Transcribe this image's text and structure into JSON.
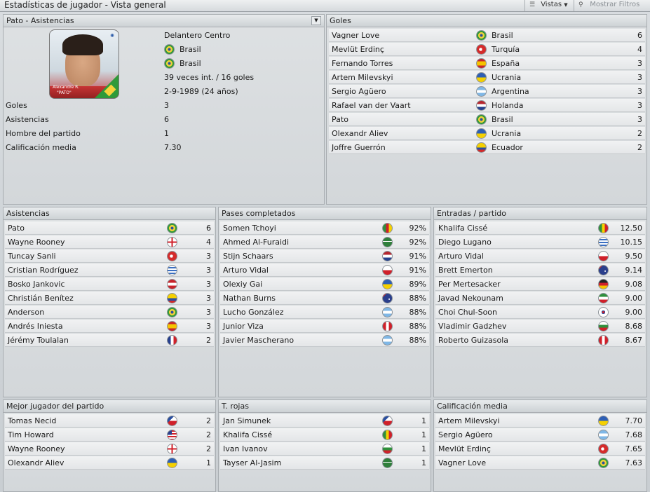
{
  "window": {
    "title": "Estadísticas de jugador - Vista general",
    "views_label": "Vistas",
    "filters_label": "Mostrar Filtros"
  },
  "player": {
    "panel_title": "Pato - Asistencias",
    "photo_caption_line1": "Alexandre R.",
    "photo_caption_line2": "\"PATO\"",
    "position": "Delantero Centro",
    "nationality": "Brasil",
    "nationality2": "Brasil",
    "caps": "39 veces int. / 16 goles",
    "dob": "2-9-1989 (24 años)",
    "stats": [
      {
        "label": "Goles",
        "value": "3"
      },
      {
        "label": "Asistencias",
        "value": "6"
      },
      {
        "label": "Hombre del partido",
        "value": "1"
      },
      {
        "label": "Calificación media",
        "value": "7.30"
      }
    ]
  },
  "goals": {
    "title": "Goles",
    "rows": [
      {
        "name": "Vagner Love",
        "flag": "brazil",
        "country": "Brasil",
        "value": "6"
      },
      {
        "name": "Mevlüt Erdinç",
        "flag": "turkey",
        "country": "Turquía",
        "value": "4"
      },
      {
        "name": "Fernando Torres",
        "flag": "spain",
        "country": "España",
        "value": "3"
      },
      {
        "name": "Artem Milevskyi",
        "flag": "ukraine",
        "country": "Ucrania",
        "value": "3"
      },
      {
        "name": "Sergio Agüero",
        "flag": "argentina",
        "country": "Argentina",
        "value": "3"
      },
      {
        "name": "Rafael van der Vaart",
        "flag": "netherlands",
        "country": "Holanda",
        "value": "3"
      },
      {
        "name": "Pato",
        "flag": "brazil",
        "country": "Brasil",
        "value": "3"
      },
      {
        "name": "Olexandr Aliev",
        "flag": "ukraine",
        "country": "Ucrania",
        "value": "2"
      },
      {
        "name": "Joffre Guerrón",
        "flag": "ecuador",
        "country": "Ecuador",
        "value": "2"
      }
    ]
  },
  "assists": {
    "title": "Asistencias",
    "rows": [
      {
        "name": "Pato",
        "flag": "brazil",
        "value": "6"
      },
      {
        "name": "Wayne Rooney",
        "flag": "england",
        "value": "4"
      },
      {
        "name": "Tuncay Sanli",
        "flag": "turkey",
        "value": "3"
      },
      {
        "name": "Cristian Rodríguez",
        "flag": "uruguay",
        "value": "3"
      },
      {
        "name": "Bosko Jankovic",
        "flag": "serbia",
        "value": "3"
      },
      {
        "name": "Christián Benítez",
        "flag": "ecuador",
        "value": "3"
      },
      {
        "name": "Anderson",
        "flag": "brazil",
        "value": "3"
      },
      {
        "name": "Andrés Iniesta",
        "flag": "spain",
        "value": "3"
      },
      {
        "name": "Jérémy Toulalan",
        "flag": "france",
        "value": "2"
      }
    ]
  },
  "passes": {
    "title": "Pases completados",
    "rows": [
      {
        "name": "Somen Tchoyi",
        "flag": "cameroon",
        "value": "92%"
      },
      {
        "name": "Ahmed Al-Furaidi",
        "flag": "saudi",
        "value": "92%"
      },
      {
        "name": "Stijn Schaars",
        "flag": "netherlands",
        "value": "91%"
      },
      {
        "name": "Arturo Vidal",
        "flag": "chile",
        "value": "91%"
      },
      {
        "name": "Olexiy Gai",
        "flag": "ukraine",
        "value": "89%"
      },
      {
        "name": "Nathan Burns",
        "flag": "australia",
        "value": "88%"
      },
      {
        "name": "Lucho González",
        "flag": "argentina",
        "value": "88%"
      },
      {
        "name": "Junior Viza",
        "flag": "peru",
        "value": "88%"
      },
      {
        "name": "Javier Mascherano",
        "flag": "argentina",
        "value": "88%"
      }
    ]
  },
  "tackles": {
    "title": "Entradas / partido",
    "rows": [
      {
        "name": "Khalifa Cissé",
        "flag": "mali",
        "value": "12.50"
      },
      {
        "name": "Diego Lugano",
        "flag": "uruguay",
        "value": "10.15"
      },
      {
        "name": "Arturo Vidal",
        "flag": "chile",
        "value": "9.50"
      },
      {
        "name": "Brett Emerton",
        "flag": "australia",
        "value": "9.14"
      },
      {
        "name": "Per Mertesacker",
        "flag": "germany",
        "value": "9.08"
      },
      {
        "name": "Javad Nekounam",
        "flag": "iran",
        "value": "9.00"
      },
      {
        "name": "Choi Chul-Soon",
        "flag": "korea",
        "value": "9.00"
      },
      {
        "name": "Vladimir Gadzhev",
        "flag": "bulgaria",
        "value": "8.68"
      },
      {
        "name": "Roberto Guizasola",
        "flag": "peru",
        "value": "8.67"
      }
    ]
  },
  "motm": {
    "title": "Mejor jugador del partido",
    "rows": [
      {
        "name": "Tomas Necid",
        "flag": "czech",
        "value": "2"
      },
      {
        "name": "Tim Howard",
        "flag": "usa",
        "value": "2"
      },
      {
        "name": "Wayne Rooney",
        "flag": "england",
        "value": "2"
      },
      {
        "name": "Olexandr Aliev",
        "flag": "ukraine",
        "value": "1"
      }
    ]
  },
  "reds": {
    "title": "T. rojas",
    "rows": [
      {
        "name": "Jan Simunek",
        "flag": "czech",
        "value": "1"
      },
      {
        "name": "Khalifa Cissé",
        "flag": "mali",
        "value": "1"
      },
      {
        "name": "Ivan Ivanov",
        "flag": "bulgaria",
        "value": "1"
      },
      {
        "name": "Tayser Al-Jasim",
        "flag": "saudi",
        "value": "1"
      }
    ]
  },
  "ratings": {
    "title": "Calificación media",
    "rows": [
      {
        "name": "Artem Milevskyi",
        "flag": "ukraine",
        "value": "7.70"
      },
      {
        "name": "Sergio Agüero",
        "flag": "argentina",
        "value": "7.68"
      },
      {
        "name": "Mevlüt Erdinç",
        "flag": "turkey",
        "value": "7.65"
      },
      {
        "name": "Vagner Love",
        "flag": "brazil",
        "value": "7.63"
      }
    ]
  },
  "flag_styles": {
    "brazil": "radial-gradient(circle at 50% 50%, #2a4fa0 0 22%, #f2d23a 23% 48%, #2f9a39 49%)",
    "turkey": "radial-gradient(circle at 42% 50%, #ffffff 0 22%, #d52b2b 23%)",
    "spain": "linear-gradient(#c8242b 0 28%, #f5c400 28% 72%, #c8242b 72%)",
    "ukraine": "linear-gradient(#2e5fb5 0 50%, #f5d000 50%)",
    "argentina": "linear-gradient(#7fb7e6 0 33%, #ffffff 33% 67%, #7fb7e6 67%)",
    "netherlands": "linear-gradient(#b6262f 0 33%, #ffffff 33% 67%, #26428e 67%)",
    "ecuador": "linear-gradient(#f5d000 0 50%, #2a4fa0 50% 75%, #d22a2a 75%)",
    "england": "linear-gradient(90deg, transparent 42%, #d0202a 42% 58%, transparent 58%), linear-gradient(transparent 42%, #d0202a 42% 58%, transparent 58%), #ffffff",
    "uruguay": "repeating-linear-gradient(#ffffff 0 2px, #3b6fc1 2px 4px)",
    "serbia": "linear-gradient(#c8242b 0 33%, #ffffff 33% 67%, #c8242b 67%)",
    "france": "linear-gradient(90deg, #263f8e 0 33%, #ffffff 33% 67%, #d0202a 67%)",
    "cameroon": "linear-gradient(90deg, #2f8f3b 0 33%, #d0202a 33% 67%, #f5d000 67%)",
    "saudi": "linear-gradient(#2f7f3b 0 38%, #ffffff 38% 46%, #2f7f3b 46%)",
    "chile": "linear-gradient(#ffffff 0 50%, #d0202a 50%)",
    "australia": "radial-gradient(circle at 70% 60%, #ffffff 0 8%, transparent 9%), linear-gradient(135deg, #c8242b 0 20%, #2a3f8c 20%)",
    "peru": "linear-gradient(90deg, #d0202a 0 33%, #ffffff 33% 67%, #d0202a 67%)",
    "mali": "linear-gradient(90deg, #2f8f3b 0 33%, #f5d000 33% 67%, #d0202a 67%)",
    "germany": "linear-gradient(#222222 0 33%, #d0202a 33% 67%, #f5c400 67%)",
    "iran": "linear-gradient(#2f8f3b 0 33%, #ffffff 33% 67%, #d0202a 67%)",
    "korea": "radial-gradient(circle at 50% 50%, #d0202a 0 18%, #2a4fa0 19% 28%, #ffffff 29%)",
    "bulgaria": "linear-gradient(#ffffff 0 33%, #2f8f3b 33% 67%, #d0202a 67%)",
    "czech": "linear-gradient(135deg, #2a4fa0 0 35%, transparent 35%), linear-gradient(#ffffff 0 50%, #d0202a 50%)",
    "usa": "linear-gradient(90deg, #2a3f8c 0 45%, transparent 45%) 0 0 / 100% 50% no-repeat, repeating-linear-gradient(#d0202a 0 2px, #ffffff 2px 4px)"
  }
}
